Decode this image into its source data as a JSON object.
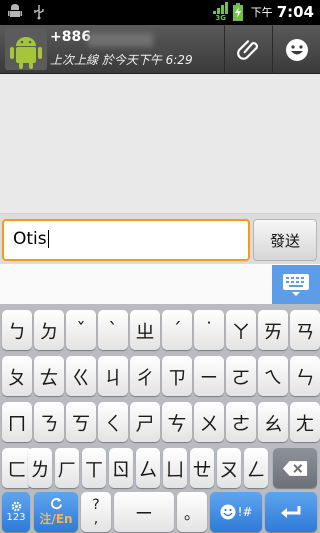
{
  "status_bar": {
    "network": "3G",
    "am_pm": "下午",
    "time": "7:04"
  },
  "header": {
    "contact_name": "+886",
    "last_seen": "上次上線 於今天下午 6:29",
    "icons": [
      "android-avatar-icon",
      "paperclip-icon",
      "smiley-icon"
    ]
  },
  "input": {
    "value": "Otis",
    "send_label": "發送"
  },
  "keyboard": {
    "row1": [
      "ㄅ",
      "ㄉ",
      "ˇ",
      "ˋ",
      "ㄓ",
      "ˊ",
      "˙",
      "ㄚ",
      "ㄞ",
      "ㄢ"
    ],
    "row2": [
      "ㄆ",
      "ㄊ",
      "ㄍ",
      "ㄐ",
      "ㄔ",
      "ㄗ",
      "ㄧ",
      "ㄛ",
      "ㄟ",
      "ㄣ"
    ],
    "row3": [
      "ㄇ",
      "ㄋ",
      "ㄎ",
      "ㄑ",
      "ㄕ",
      "ㄘ",
      "ㄨ",
      "ㄜ",
      "ㄠ",
      "ㄤ"
    ],
    "row4": [
      "ㄈ",
      "ㄌ",
      "ㄏ",
      "ㄒ",
      "ㄖ",
      "ㄙ",
      "ㄩ",
      "ㄝ",
      "ㄡ",
      "ㄥ"
    ],
    "bottom": {
      "mode_label": "123",
      "lang_label": "注/En",
      "question": "?",
      "comma": ",",
      "space": "ㄧ",
      "dot": "。",
      "emoji_label": "!#"
    }
  },
  "colors": {
    "status_bar": "#000000",
    "header": "#4a4a4a",
    "input_border": "#f39c1c",
    "accent_blue": "#3f8be0",
    "keyboard_bg": "#b8bcc1"
  }
}
